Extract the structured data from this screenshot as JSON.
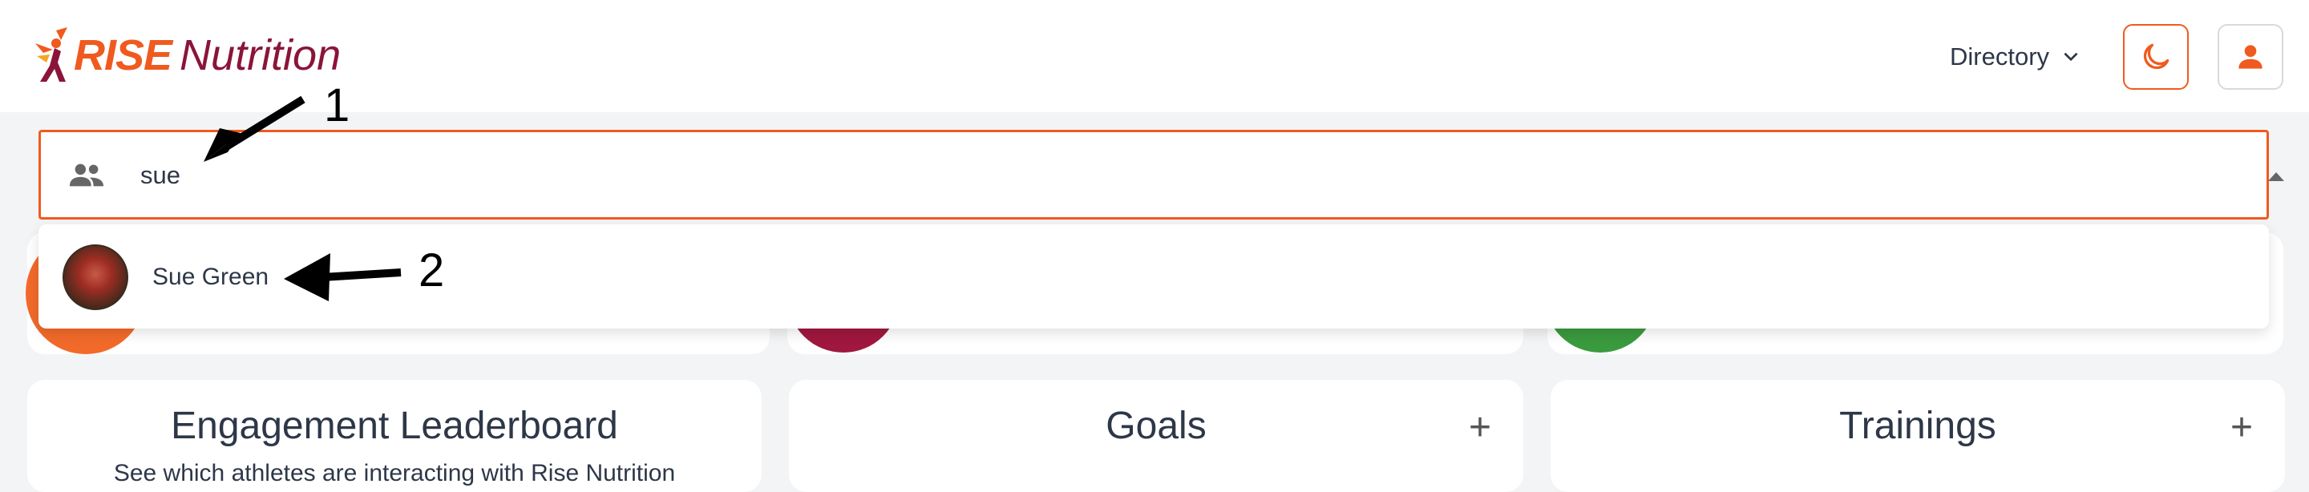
{
  "header": {
    "logo_brand": "RISE",
    "logo_suffix": "Nutrition",
    "directory_label": "Directory"
  },
  "search": {
    "value": "sue"
  },
  "dropdown": {
    "options": [
      {
        "label": "Sue Green"
      }
    ]
  },
  "cards": [
    {
      "title": "Engagement Leaderboard",
      "subtitle": "See which athletes are interacting with Rise Nutrition"
    },
    {
      "title": "Goals",
      "action": "+"
    },
    {
      "title": "Trainings",
      "action": "+"
    }
  ],
  "annotations": {
    "arrow1_label": "1",
    "arrow2_label": "2"
  },
  "colors": {
    "accent": "#f05a1f",
    "brand_secondary": "#8a1538"
  }
}
